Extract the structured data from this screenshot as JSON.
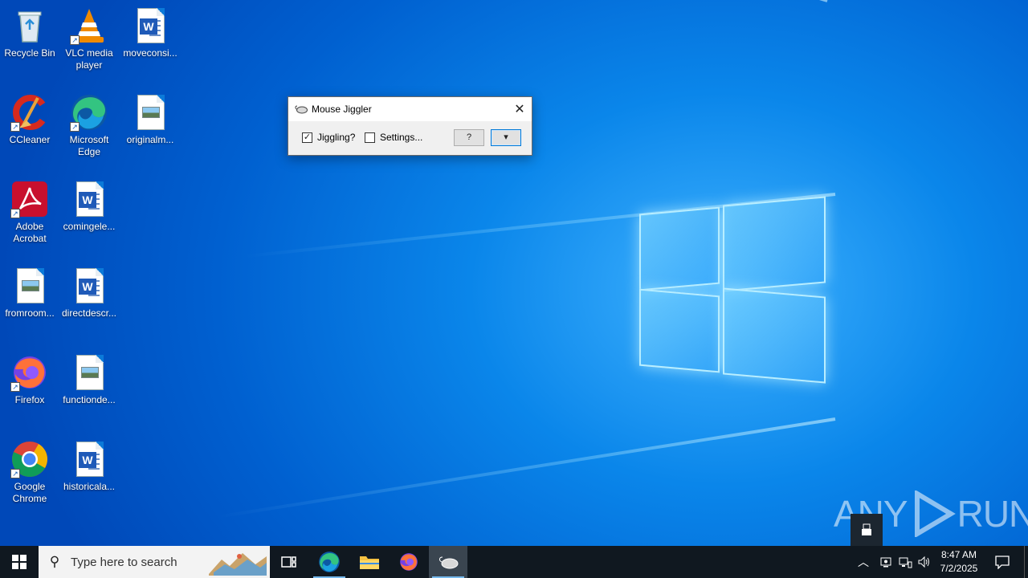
{
  "desktop": {
    "icons": [
      {
        "label": "Recycle Bin",
        "icon": "recycle-bin-icon"
      },
      {
        "label": "VLC media player",
        "icon": "vlc-icon"
      },
      {
        "label": "moveconsi...",
        "icon": "word-doc-icon"
      },
      {
        "label": "CCleaner",
        "icon": "ccleaner-icon"
      },
      {
        "label": "Microsoft Edge",
        "icon": "edge-icon"
      },
      {
        "label": "originalm...",
        "icon": "image-file-icon"
      },
      {
        "label": "Adobe Acrobat",
        "icon": "acrobat-icon"
      },
      {
        "label": "comingele...",
        "icon": "word-doc-icon"
      },
      {
        "label": "fromroom...",
        "icon": "image-file-icon"
      },
      {
        "label": "directdescr...",
        "icon": "word-doc-icon"
      },
      {
        "label": "Firefox",
        "icon": "firefox-icon"
      },
      {
        "label": "functionde...",
        "icon": "image-file-icon"
      },
      {
        "label": "Google Chrome",
        "icon": "chrome-icon"
      },
      {
        "label": "historicala...",
        "icon": "word-doc-icon"
      }
    ]
  },
  "dialog": {
    "title": "Mouse Jiggler",
    "jiggling_label": "Jiggling?",
    "jiggling_checked": true,
    "settings_label": "Settings...",
    "settings_checked": false,
    "help_button": "?",
    "expand_button": "▾"
  },
  "taskbar": {
    "search_placeholder": "Type here to search",
    "apps": [
      "task-view-icon",
      "edge-icon",
      "file-explorer-icon",
      "firefox-icon",
      "mouse-jiggler-icon"
    ],
    "active_app": "mouse-jiggler-icon",
    "time": "8:47 AM",
    "date": "7/2/2025"
  },
  "watermark": {
    "left": "ANY",
    "right": "RUN"
  },
  "colors": {
    "taskbar": "#101820",
    "desktop_accent": "#0a86ea",
    "focus_blue": "#0078d7"
  }
}
